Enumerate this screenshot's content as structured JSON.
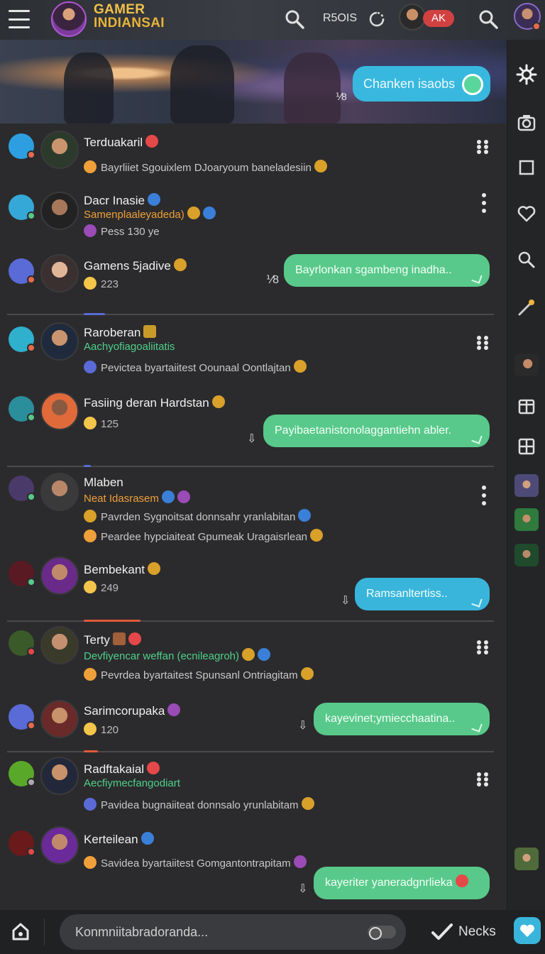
{
  "header": {
    "brand_line1": "GAMER",
    "brand_line2": "INDIANSAI",
    "code": "R5OIS",
    "badge": "AK"
  },
  "banner": {
    "bubble_text": "Chanken isaobs",
    "mark": "⅟8"
  },
  "feed": [
    {
      "name": "Terduakaril",
      "meta": "Bayrliiet Sgouixlem DJoaryoum baneladesiin",
      "badge_color": "#e54848"
    },
    {
      "name": "Dacr Inasie",
      "sub": "Samenplaaleyadeda)",
      "meta": "Pess 130 ye"
    },
    {
      "name": "Gamens 5jadive",
      "count": "223",
      "mark": "⅟8",
      "bubble": "Bayrlonkan sgambeng inadha.."
    },
    {
      "name": "Raroberan",
      "sub": "Aachyofiagoaliitatis",
      "meta": "Pevictea byartaiitest Oounaal Oontlajtan"
    },
    {
      "name": "Fasiing deran Hardstan",
      "count": "125",
      "bubble": "Payibaetanistonolaggantiehn abler."
    },
    {
      "name": "Mlaben",
      "sub": "Neat Idasrasem",
      "meta1": "Pavrden Sygnoitsat donnsahr yranlabitan",
      "meta2": "Peardee hypciaiteat Gpumeak Uragaisrlean"
    },
    {
      "name": "Bembekant",
      "count": "249",
      "bubble": "Ramsanltertiss.."
    },
    {
      "name": "Terty",
      "sub": "Devfiyencar weffan (ecnileagroh)",
      "meta": "Pevrdea byartaitest Spunsanl Ontriagitam"
    },
    {
      "name": "Sarimcorupaka",
      "count": "120",
      "bubble": "kayevinet;ymiecchaatina.."
    },
    {
      "name": "Radftakaial",
      "sub": "Aecfiymecfangodiart",
      "meta": "Pavidea bugnaiiteat donnsalo yrunlabitam"
    },
    {
      "name": "Kerteilean",
      "meta": "Savidea byartaiitest Gomgantontrapitam",
      "bubble": "kayeriter yaneradgnrlieka"
    }
  ],
  "bottom": {
    "placeholder": "Konmniitabradoranda...",
    "label": "Necks"
  },
  "colors": {
    "accent_blue": "#39b5dc",
    "accent_green": "#58c98a",
    "brand_gold": "#f0c24a",
    "badge_red": "#d24141"
  }
}
